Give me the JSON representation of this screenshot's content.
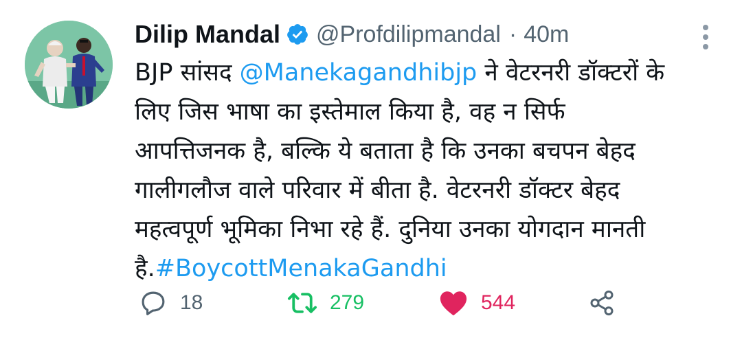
{
  "tweet": {
    "author": {
      "name": "Dilip Mandal",
      "handle": "@Profdilipmandal",
      "separator": "·",
      "time": "40m"
    },
    "colors": {
      "link": "#1d9bf0",
      "retweet": "#17bf63",
      "like": "#e0245e",
      "muted": "#536471",
      "verified": "#1d9bf0"
    },
    "text": {
      "line1_pre": "BJP सांसद ",
      "line1_mention": "@Manekagandhibjp",
      "line1_post": " ने वेटरनरी डॉक्टरों के",
      "line2": "लिए जिस भाषा का इस्तेमाल किया है, वह न सिर्फ",
      "line3": "आपत्तिजनक है, बल्कि ये बताता है कि उनका बचपन बेहद",
      "line4": "गालीगलौज वाले परिवार में बीता है. वेटरनरी डॉक्टर बेहद",
      "line5": "महत्वपूर्ण भूमिका निभा रहे हैं. दुनिया उनका योगदान मानती",
      "line6_pre": "है.",
      "line6_hashtag": "#BoycottMenakaGandhi"
    },
    "actions": {
      "replies": "18",
      "retweets": "279",
      "likes": "544"
    },
    "icons": {
      "avatar": "avatar",
      "verified": "verified-badge-icon",
      "more": "more-vertical-icon",
      "reply": "reply-icon",
      "retweet": "retweet-icon",
      "like": "heart-icon",
      "share": "share-icon"
    }
  }
}
